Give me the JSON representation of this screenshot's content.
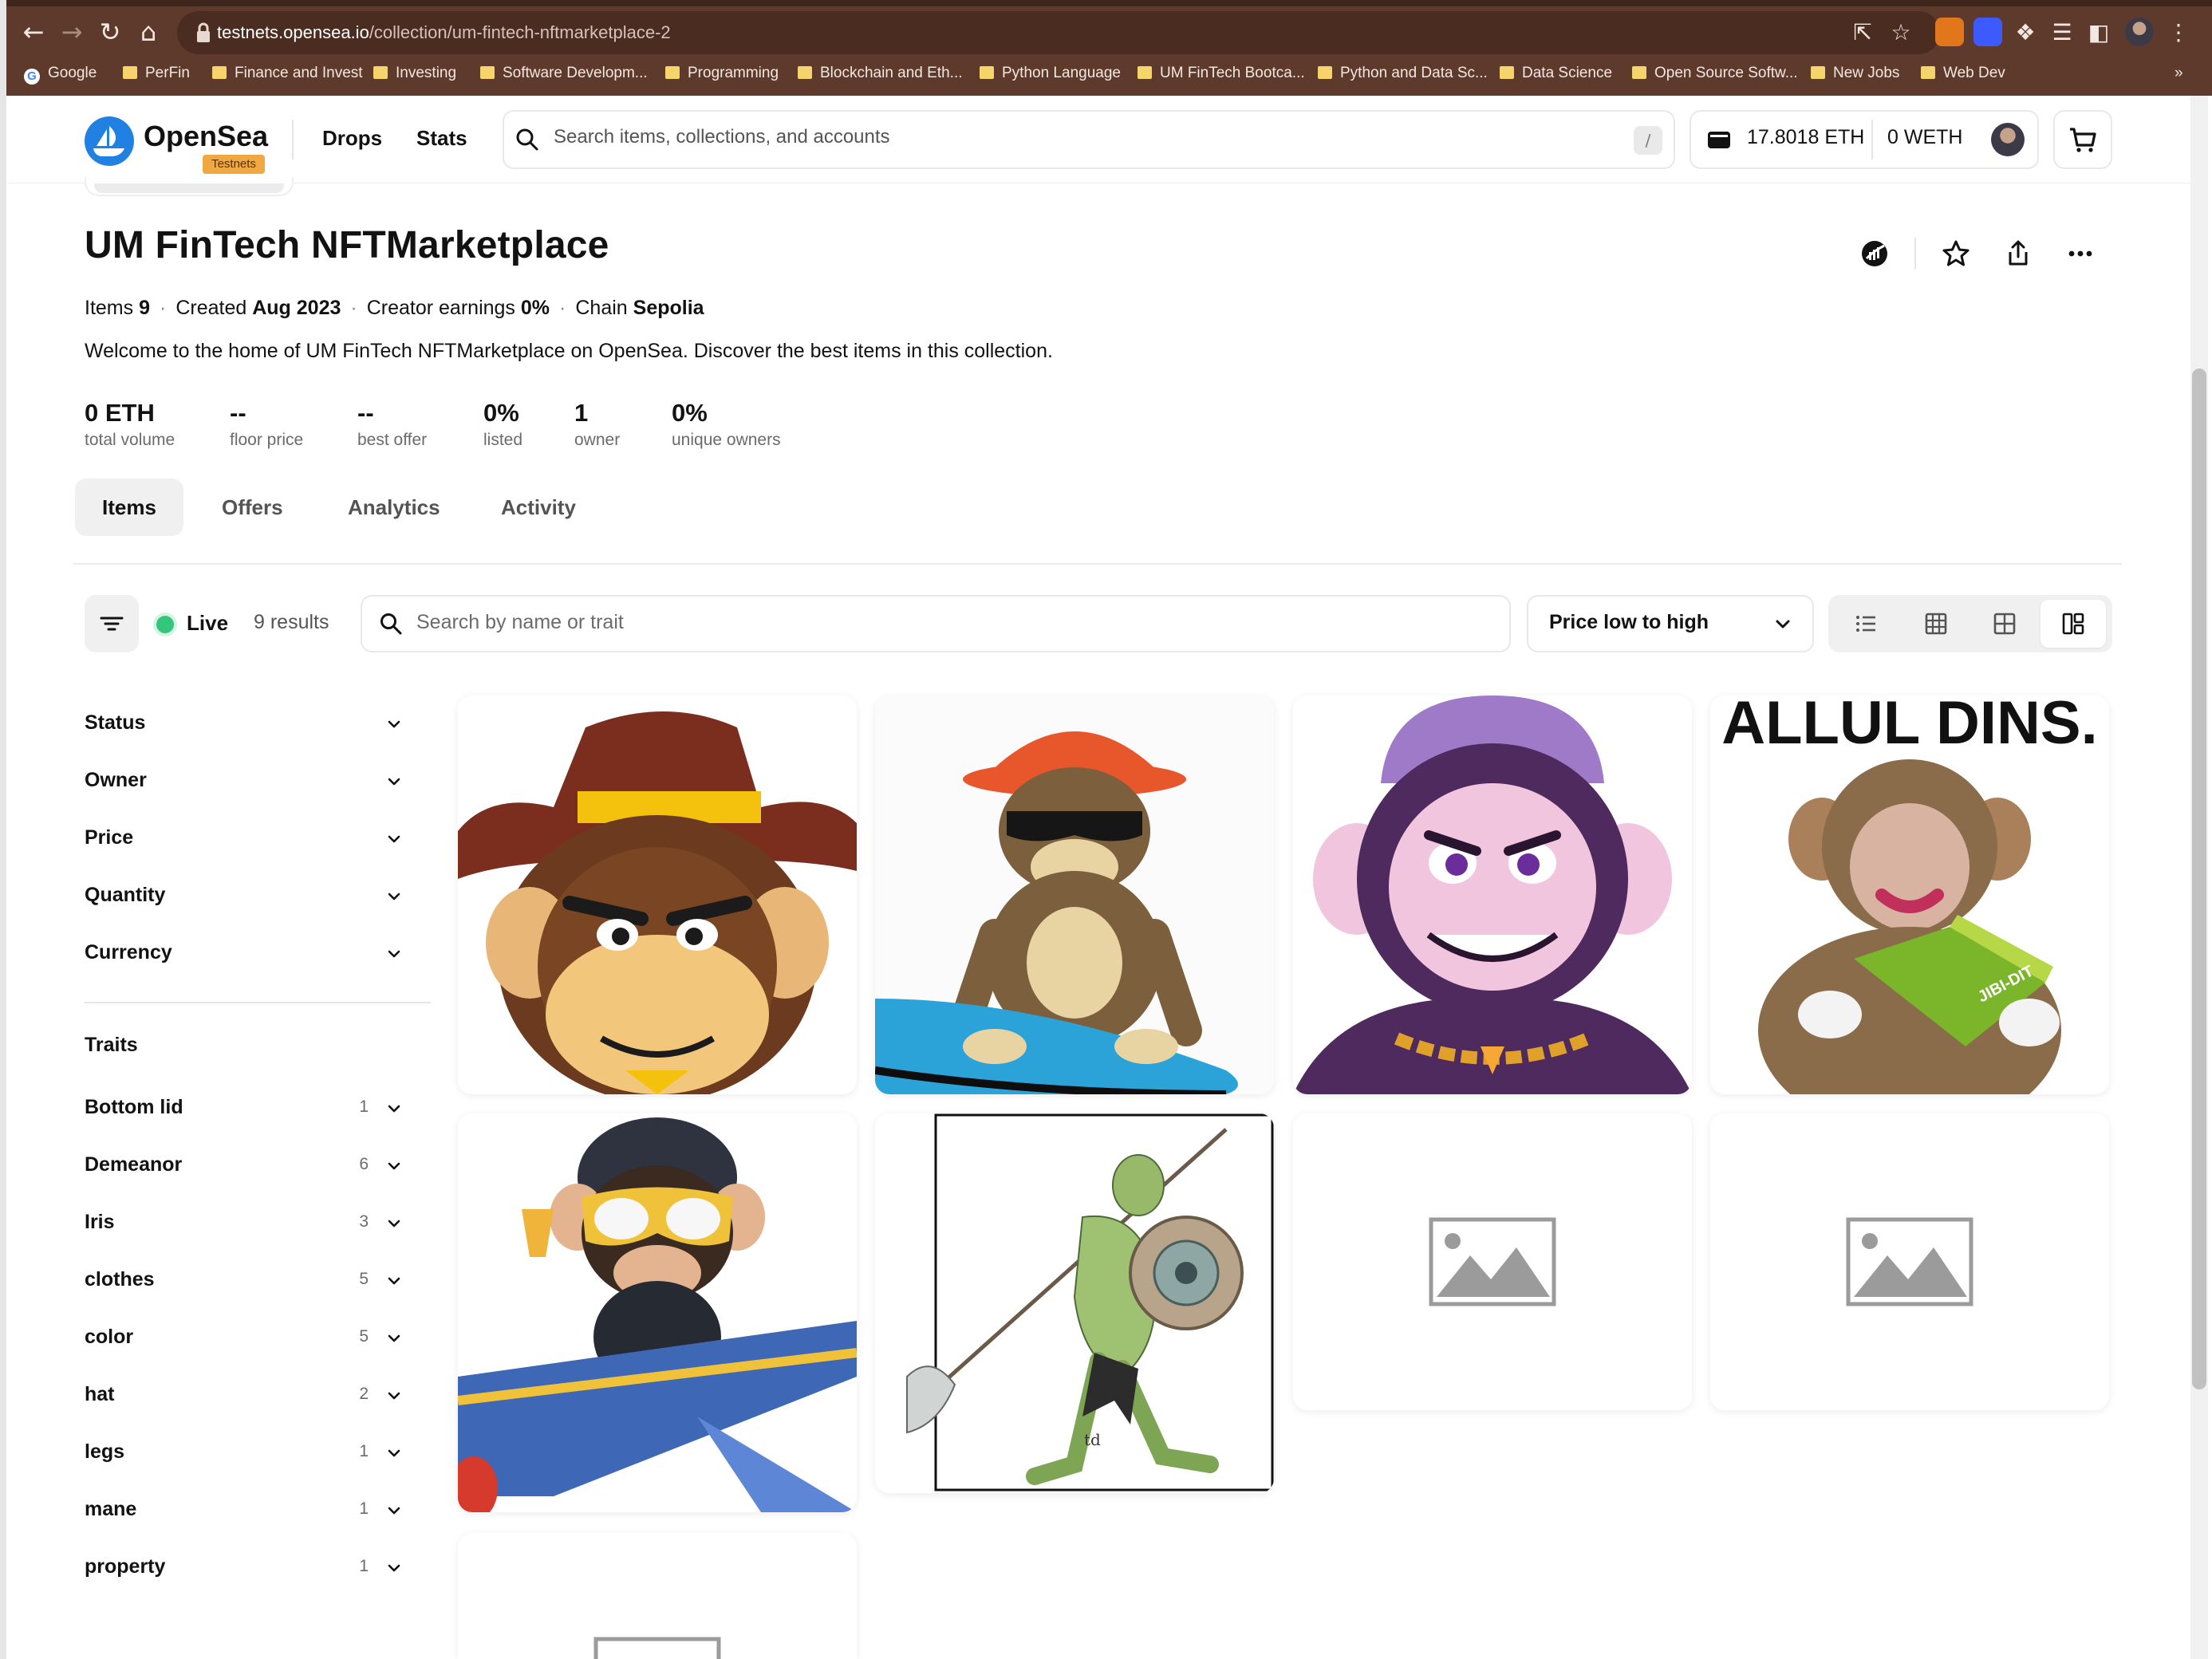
{
  "browser": {
    "url_host": "testnets.opensea.io",
    "url_path": "/collection/um-fintech-nftmarketplace-2",
    "bookmarks": [
      "Google",
      "PerFin",
      "Finance and Invest",
      "Investing",
      "Software Developm...",
      "Programming",
      "Blockchain and Eth...",
      "Python Language",
      "UM FinTech Bootca...",
      "Python and Data Sc...",
      "Data Science",
      "Open Source Softw...",
      "New Jobs",
      "Web Dev"
    ],
    "more_bookmarks": "»"
  },
  "header": {
    "logo_text": "OpenSea",
    "badge": "Testnets",
    "nav": [
      "Drops",
      "Stats"
    ],
    "search_placeholder": "Search items, collections, and accounts",
    "search_shortcut": "/",
    "wallet_eth": "17.8018 ETH",
    "wallet_weth": "0 WETH"
  },
  "collection": {
    "title": "UM FinTech NFTMarketplace",
    "meta": {
      "items_label": "Items",
      "items_value": "9",
      "created_label": "Created",
      "created_value": "Aug 2023",
      "earnings_label": "Creator earnings",
      "earnings_value": "0%",
      "chain_label": "Chain",
      "chain_value": "Sepolia"
    },
    "description": "Welcome to the home of UM FinTech NFTMarketplace on OpenSea. Discover the best items in this collection.",
    "stats": [
      {
        "value": "0 ETH",
        "label": "total volume"
      },
      {
        "value": "--",
        "label": "floor price"
      },
      {
        "value": "--",
        "label": "best offer"
      },
      {
        "value": "0%",
        "label": "listed"
      },
      {
        "value": "1",
        "label": "owner"
      },
      {
        "value": "0%",
        "label": "unique owners"
      }
    ]
  },
  "tabs": [
    "Items",
    "Offers",
    "Analytics",
    "Activity"
  ],
  "toolbar": {
    "live_label": "Live",
    "results": "9 results",
    "search_placeholder": "Search by name or trait",
    "sort_value": "Price low to high"
  },
  "filters": [
    "Status",
    "Owner",
    "Price",
    "Quantity",
    "Currency"
  ],
  "traits_heading": "Traits",
  "traits": [
    {
      "name": "Bottom lid",
      "count": "1"
    },
    {
      "name": "Demeanor",
      "count": "6"
    },
    {
      "name": "Iris",
      "count": "3"
    },
    {
      "name": "clothes",
      "count": "5"
    },
    {
      "name": "color",
      "count": "5"
    },
    {
      "name": "hat",
      "count": "2"
    },
    {
      "name": "legs",
      "count": "1"
    },
    {
      "name": "mane",
      "count": "1"
    },
    {
      "name": "property",
      "count": "1"
    }
  ],
  "cards": {
    "reading_monkey_headline": "ALLUL DINS.",
    "reading_monkey_book": "JIBI-DIT",
    "lizard_signature": "td"
  },
  "colors": {
    "brand_blue": "#2081e2",
    "testnet_badge": "#f0a843",
    "live_green": "#34c77b",
    "chrome_brown": "#5e3a2c"
  }
}
